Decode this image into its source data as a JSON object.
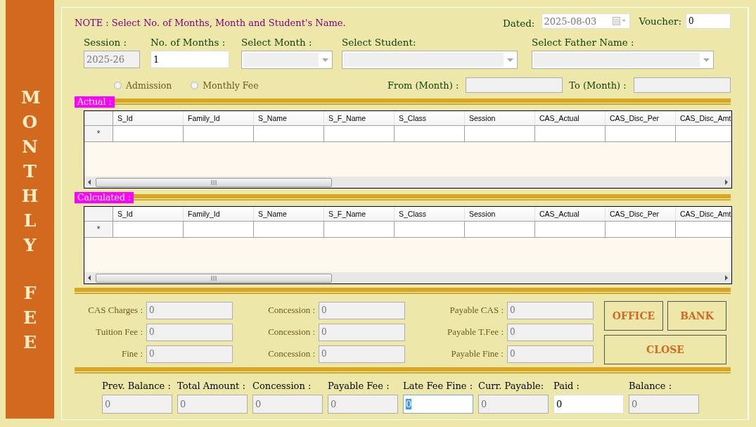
{
  "banner": {
    "words": [
      "MONTHLY",
      "FEE"
    ]
  },
  "note": "NOTE : Select No. of Months, Month and Student's Name.",
  "dated": {
    "label": "Dated:",
    "value": "2025-08-03"
  },
  "voucher": {
    "label": "Voucher:",
    "value": "0"
  },
  "selection": [
    {
      "kind": "text",
      "label": "Session :",
      "value": "2025-26",
      "disabled": true
    },
    {
      "kind": "text",
      "label": "No. of Months :",
      "value": "1",
      "disabled": false
    },
    {
      "kind": "dropdown",
      "label": "Select Month :",
      "disabled": true
    },
    {
      "kind": "dropdown",
      "label": "Select Student:",
      "disabled": true
    },
    {
      "kind": "dropdown",
      "label": "Select Father Name :",
      "disabled": true
    }
  ],
  "fee_type": [
    {
      "label": "Admission",
      "selected": false
    },
    {
      "label": "Monthly Fee",
      "selected": false
    }
  ],
  "from_month": {
    "label": "From (Month) :"
  },
  "to_month": {
    "label": "To (Month) :"
  },
  "grids": [
    {
      "title": "Actual :",
      "new_row_marker": "*",
      "columns": [
        "S_Id",
        "Family_Id",
        "S_Name",
        "S_F_Name",
        "S_Class",
        "Session",
        "CAS_Actual",
        "CAS_Disc_Per",
        "CAS_Disc_Amt"
      ]
    },
    {
      "title": "Calculated :",
      "new_row_marker": "*",
      "columns": [
        "S_Id",
        "Family_Id",
        "S_Name",
        "S_F_Name",
        "S_Class",
        "Session",
        "CAS_Actual",
        "CAS_Disc_Per",
        "CAS_Disc_Amt"
      ]
    }
  ],
  "charges": [
    [
      {
        "label": "CAS Charges :",
        "value": "0"
      },
      {
        "label": "Tuition Fee :",
        "value": "0"
      },
      {
        "label": "Fine :",
        "value": "0"
      }
    ],
    [
      {
        "label": "Concession :",
        "value": "0"
      },
      {
        "label": "Concession :",
        "value": "0"
      },
      {
        "label": "Concession :",
        "value": "0"
      }
    ],
    [
      {
        "label": "Payable CAS :",
        "value": "0"
      },
      {
        "label": "Payable T.Fee :",
        "value": "0"
      },
      {
        "label": "Payable Fine :",
        "value": "0"
      }
    ]
  ],
  "buttons": [
    {
      "label": "OFFICE",
      "kind": "small"
    },
    {
      "label": "BANK",
      "kind": "small"
    },
    {
      "label": "CLOSE",
      "kind": "wide"
    }
  ],
  "summary": [
    {
      "label": "Prev. Balance :",
      "value": "0",
      "disabled": true,
      "text_selected": false
    },
    {
      "label": "Total Amount :",
      "value": "0",
      "disabled": true,
      "text_selected": false
    },
    {
      "label": "Concession :",
      "value": "0",
      "disabled": true,
      "text_selected": false
    },
    {
      "label": "Payable Fee :",
      "value": "0",
      "disabled": true,
      "text_selected": false
    },
    {
      "label": "Late Fee Fine :",
      "value": "0",
      "disabled": false,
      "text_selected": true
    },
    {
      "label": "Curr. Payable:",
      "value": "0",
      "disabled": true,
      "text_selected": false
    },
    {
      "label": "Paid :",
      "value": "0",
      "disabled": false,
      "text_selected": false
    },
    {
      "label": "Balance :",
      "value": "0",
      "disabled": true,
      "text_selected": false
    }
  ]
}
